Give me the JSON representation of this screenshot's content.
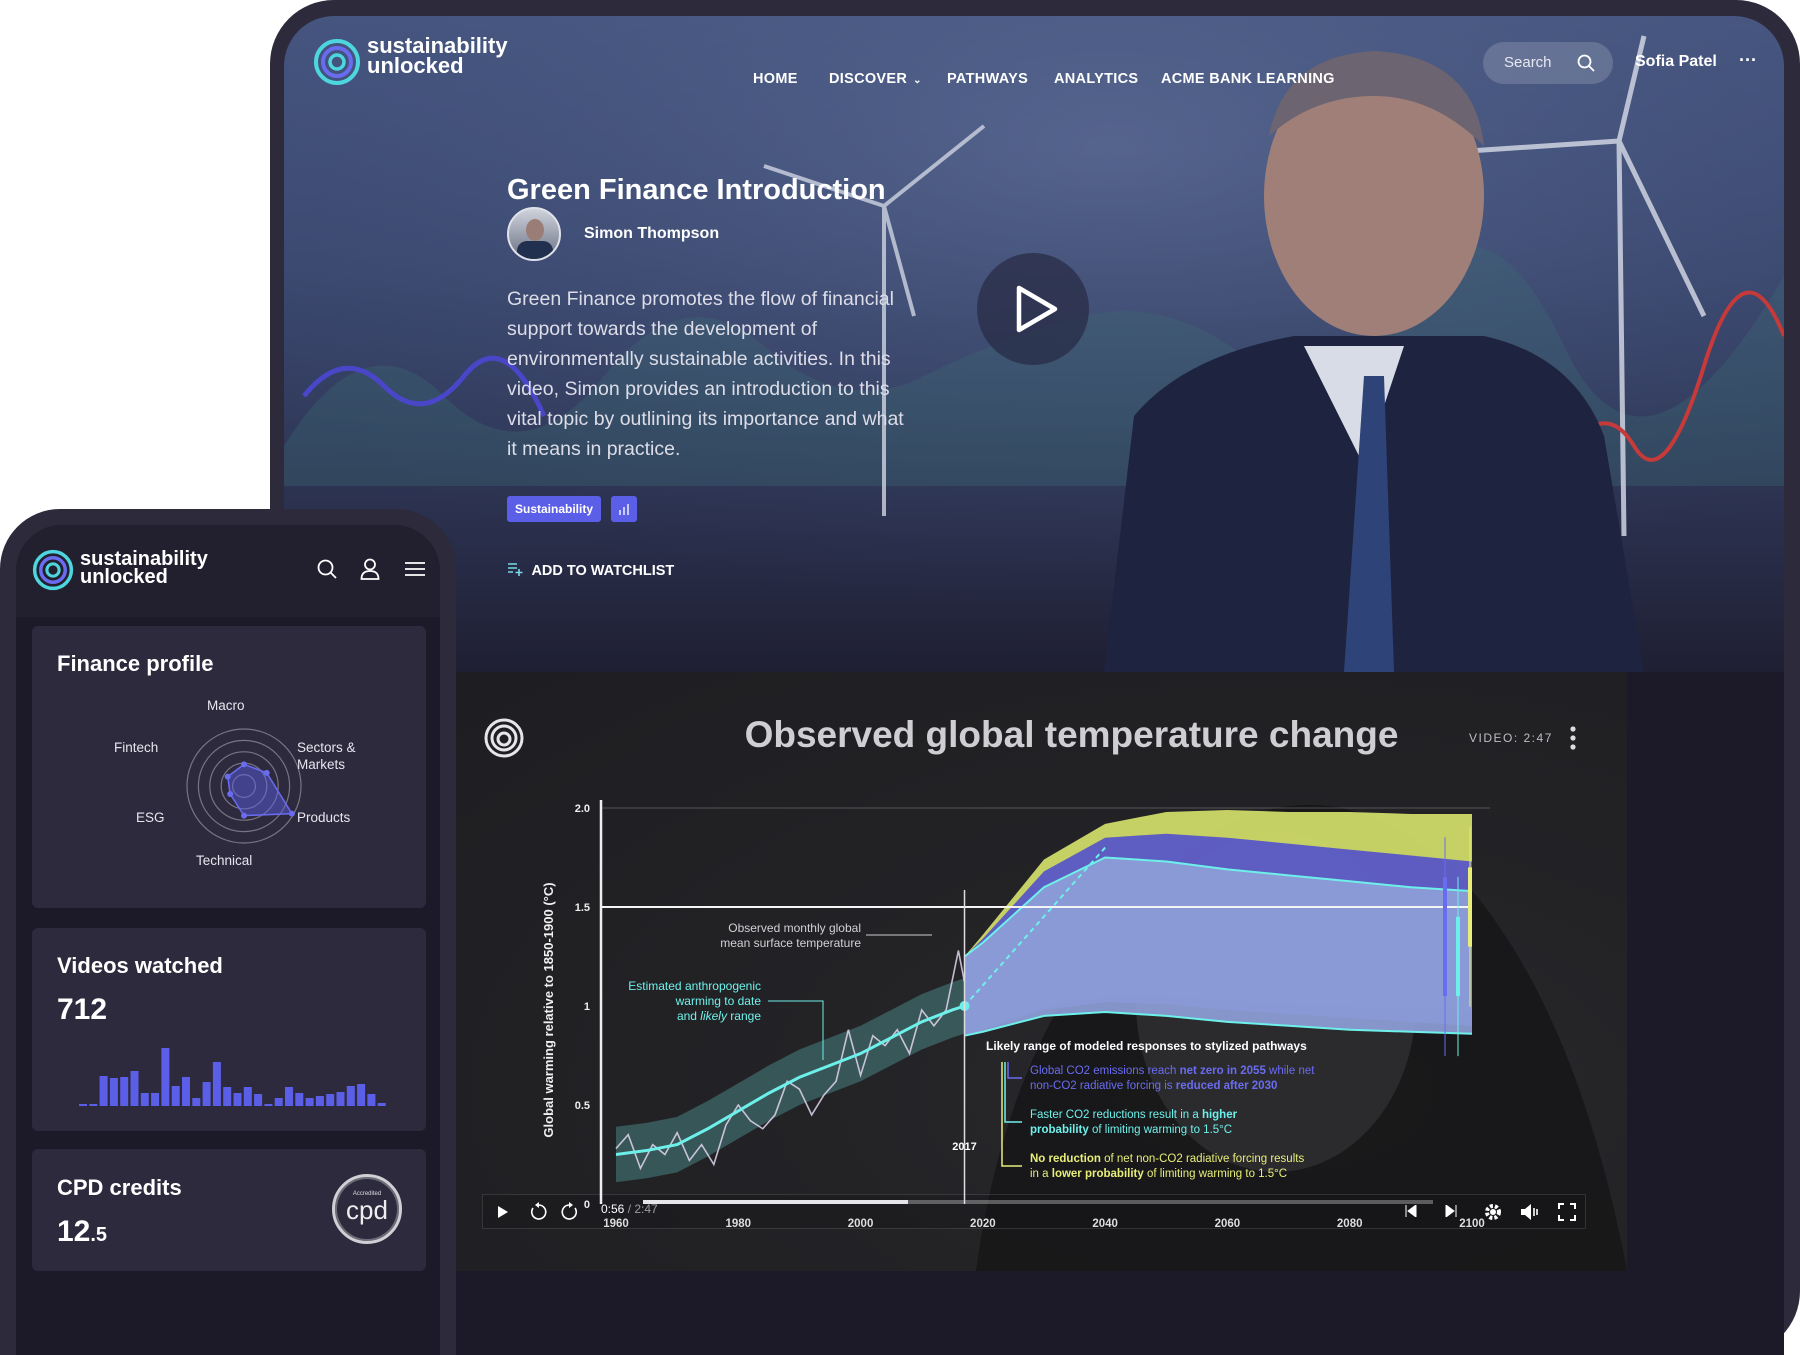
{
  "brand": {
    "line1": "sustainability",
    "line2": "unlocked",
    "accent": "#5b5fe8",
    "teal": "#5ee3e0"
  },
  "nav": {
    "items": [
      {
        "label": "HOME"
      },
      {
        "label": "DISCOVER",
        "has_dropdown": true
      },
      {
        "label": "PATHWAYS"
      },
      {
        "label": "ANALYTICS"
      },
      {
        "label": "ACME BANK LEARNING"
      }
    ],
    "search_placeholder": "Search",
    "user_name": "Sofia Patel",
    "more_icon": "ellipsis-icon"
  },
  "hero": {
    "title": "Green Finance Introduction",
    "author": "Simon Thompson",
    "description_lines": [
      "Green Finance promotes the flow of financial",
      "support towards the development of",
      "environmentally sustainable activities. In this",
      "video, Simon provides an introduction to this",
      "vital topic by outlining its importance and what",
      "it means in practice."
    ],
    "tag": "Sustainability",
    "tag_icon": "bar-chart-icon",
    "watchlist_label": "ADD TO WATCHLIST"
  },
  "video": {
    "title": "Observed global temperature change",
    "duration_label": "VIDEO: 2:47",
    "current_time": "0:56",
    "total_time": "/ 2:47",
    "progress_fraction": 0.335,
    "rewind_label": "10",
    "forward_label": "10"
  },
  "chart_data": {
    "type": "line",
    "title": "Observed global temperature change",
    "ylabel": "Global warming relative to 1850-1900 (°C)",
    "xlim": [
      1958,
      2100
    ],
    "ylim": [
      0,
      2.0
    ],
    "yticks": [
      "0",
      "0.5",
      "1",
      "1.5",
      "2.0"
    ],
    "ytick_values": [
      0,
      0.5,
      1,
      1.5,
      2.0
    ],
    "xticks": [
      "1960",
      "1980",
      "2000",
      "2020",
      "2040",
      "2060",
      "2080",
      "2100"
    ],
    "xtick_values": [
      1960,
      1980,
      2000,
      2020,
      2040,
      2060,
      2080,
      2100
    ],
    "reference_line": 1.5,
    "marker_year": "2017",
    "observed_monthly": {
      "x": [
        1960,
        1962,
        1964,
        1966,
        1968,
        1970,
        1972,
        1974,
        1976,
        1978,
        1980,
        1982,
        1984,
        1986,
        1988,
        1990,
        1992,
        1994,
        1996,
        1998,
        2000,
        2002,
        2004,
        2006,
        2008,
        2010,
        2012,
        2014,
        2016,
        2017
      ],
      "y": [
        0.28,
        0.35,
        0.18,
        0.3,
        0.25,
        0.36,
        0.22,
        0.3,
        0.2,
        0.4,
        0.5,
        0.42,
        0.38,
        0.45,
        0.62,
        0.58,
        0.45,
        0.55,
        0.62,
        0.88,
        0.65,
        0.85,
        0.8,
        0.88,
        0.76,
        0.98,
        0.9,
        0.98,
        1.28,
        1.12
      ]
    },
    "anthropogenic": {
      "x": [
        1960,
        1965,
        1970,
        1975,
        1980,
        1985,
        1990,
        1995,
        2000,
        2005,
        2010,
        2015,
        2017
      ],
      "y": [
        0.25,
        0.27,
        0.3,
        0.38,
        0.47,
        0.56,
        0.64,
        0.7,
        0.76,
        0.84,
        0.92,
        0.98,
        1.0
      ],
      "likely_range": 0.14
    },
    "pathways": {
      "x": [
        2017,
        2020,
        2030,
        2040,
        2050,
        2060,
        2070,
        2080,
        2090,
        2100
      ],
      "series": [
        {
          "color": "#d4e06a",
          "upper": [
            1.25,
            1.36,
            1.74,
            1.92,
            1.98,
            1.99,
            1.98,
            1.98,
            1.97,
            1.97
          ],
          "lower": [
            0.85,
            0.88,
            1.0,
            1.05,
            1.05,
            1.03,
            1.01,
            1.0,
            0.99,
            0.98
          ]
        },
        {
          "color": "#5552c9",
          "upper": [
            1.25,
            1.34,
            1.68,
            1.85,
            1.87,
            1.85,
            1.82,
            1.79,
            1.76,
            1.73
          ],
          "lower": [
            0.85,
            0.88,
            0.98,
            1.02,
            1.01,
            0.98,
            0.96,
            0.94,
            0.92,
            0.9
          ]
        },
        {
          "color": "#8e9fd8",
          "upper": [
            1.25,
            1.32,
            1.6,
            1.75,
            1.73,
            1.69,
            1.66,
            1.63,
            1.6,
            1.58
          ],
          "lower": [
            0.85,
            0.87,
            0.95,
            0.97,
            0.95,
            0.92,
            0.9,
            0.88,
            0.87,
            0.86
          ]
        }
      ]
    },
    "annotations": {
      "observed": [
        "Observed monthly global",
        "mean surface temperature"
      ],
      "anthropogenic": [
        [
          {
            "t": "Estimated anthropogenic"
          }
        ],
        [
          {
            "t": "warming to date"
          }
        ],
        [
          {
            "t": "and "
          },
          {
            "t": "likely",
            "i": true
          },
          {
            "t": " range"
          }
        ]
      ],
      "pathways_heading": "Likely range of modeled responses to stylized pathways",
      "pathway_notes": [
        {
          "color": "#6a6cf0",
          "lines": [
            [
              {
                "t": "Global CO2 emissions reach "
              },
              {
                "t": "net zero in 2055",
                "b": true
              },
              {
                "t": " while net"
              }
            ],
            [
              {
                "t": "non-CO2 radiative forcing is "
              },
              {
                "t": "reduced after 2030",
                "b": true
              }
            ]
          ]
        },
        {
          "color": "#6ef0ea",
          "lines": [
            [
              {
                "t": "Faster CO2 reductions result in a "
              },
              {
                "t": "higher",
                "b": true
              }
            ],
            [
              {
                "t": "probability",
                "b": true
              },
              {
                "t": " of limiting warming to 1.5°C"
              }
            ]
          ]
        },
        {
          "color": "#e8ee78",
          "lines": [
            [
              {
                "t": "No reduction",
                "b": true
              },
              {
                "t": " of net non-CO2 radiative forcing results"
              }
            ],
            [
              {
                "t": "in a "
              },
              {
                "t": "lower probability",
                "b": true
              },
              {
                "t": " of limiting warming to 1.5°C"
              }
            ]
          ]
        }
      ]
    }
  },
  "mobile": {
    "finance_profile": {
      "title": "Finance profile",
      "axes": [
        {
          "label": "Macro",
          "value": 0.38
        },
        {
          "label": "Sectors & Markets",
          "value": 0.46
        },
        {
          "label": "Products",
          "value": 0.97
        },
        {
          "label": "Technical",
          "value": 0.52
        },
        {
          "label": "ESG",
          "value": 0.28
        },
        {
          "label": "Fintech",
          "value": 0.33
        }
      ]
    },
    "videos_watched": {
      "title": "Videos watched",
      "value": "712",
      "bars": [
        1,
        2,
        30,
        28,
        29,
        35,
        13,
        13,
        58,
        20,
        29,
        8,
        24,
        44,
        19,
        13,
        19,
        12,
        1,
        8,
        19,
        13,
        8,
        10,
        12,
        14,
        20,
        22,
        12,
        3
      ]
    },
    "cpd": {
      "title": "CPD credits",
      "value_int": "12",
      "value_dec": ".5",
      "badge_small": "Accredited",
      "badge_text": "cpd"
    }
  }
}
